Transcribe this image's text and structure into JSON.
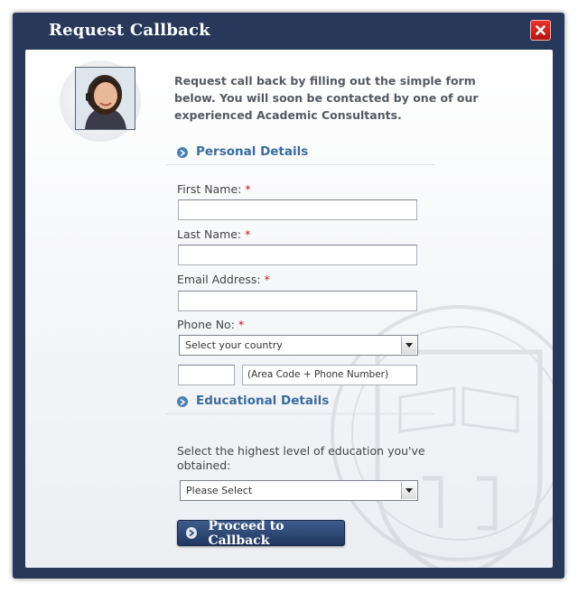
{
  "dialog": {
    "title": "Request Callback",
    "intro": "Request call back by filling out the simple form below. You will soon be contacted by one of our experienced Academic Consultants."
  },
  "sections": {
    "personal": "Personal Details",
    "education": "Educational Details"
  },
  "fields": {
    "first_name": {
      "label": "First Name:",
      "required": "*",
      "value": ""
    },
    "last_name": {
      "label": "Last Name:",
      "required": "*",
      "value": ""
    },
    "email": {
      "label": "Email Address:",
      "required": "*",
      "value": ""
    },
    "phone": {
      "label": "Phone No:",
      "required": "*",
      "country_selected": "Select your country",
      "code_value": "",
      "number_hint": "(Area Code + Phone Number)"
    },
    "education_level": {
      "label": "Select the highest level of education you've obtained:",
      "selected": "Please Select"
    }
  },
  "actions": {
    "submit_label": "Proceed to Callback"
  },
  "icons": {
    "close": "close-icon",
    "section": "chevron-right-circle-icon",
    "dropdown": "triangle-down-icon"
  },
  "colors": {
    "frame": "#27385a",
    "close": "#d3201a",
    "section_title": "#3a6c9e",
    "required": "#c0191c",
    "button": "#2e4877"
  }
}
